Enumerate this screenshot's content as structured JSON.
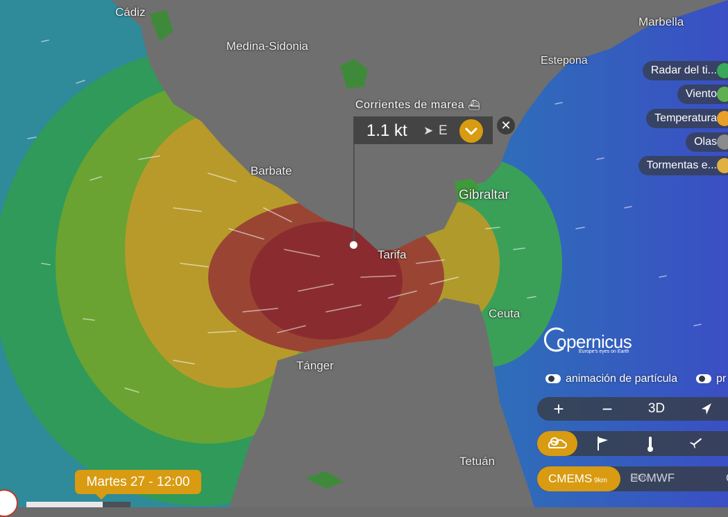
{
  "map": {
    "cities": [
      {
        "key": "cadiz",
        "label": "Cádiz"
      },
      {
        "key": "medina",
        "label": "Medina-Sidonia"
      },
      {
        "key": "marbella",
        "label": "Marbella"
      },
      {
        "key": "estepona",
        "label": "Estepona"
      },
      {
        "key": "barbate",
        "label": "Barbate"
      },
      {
        "key": "gibraltar",
        "label": "Gibraltar"
      },
      {
        "key": "tarifa",
        "label": "Tarifa"
      },
      {
        "key": "ceuta",
        "label": "Ceuta"
      },
      {
        "key": "tanger",
        "label": "Tánger"
      },
      {
        "key": "tetuan",
        "label": "Tetuán"
      }
    ],
    "colors": {
      "land": "#6e6e6e",
      "land_light": "#7a7a7a",
      "sea_blue": "#2f5fc4",
      "current_strong": "#8a2a2a",
      "accent": "#d89b11"
    }
  },
  "popup": {
    "layer_label": "Corrientes de marea",
    "layer_icon": "boat-waves-icon",
    "value": "1.1 kt",
    "direction_arrow": "➤",
    "direction": "E",
    "expand_icon": "chevron-down-icon",
    "close_icon": "close-icon"
  },
  "layers": [
    {
      "label": "Radar del ti...",
      "color": "#3aa85a"
    },
    {
      "label": "Viento",
      "color": "#5fb052"
    },
    {
      "label": "Temperatura",
      "color": "#e8a02a"
    },
    {
      "label": "Olas",
      "color": "#8a8a8a"
    },
    {
      "label": "Tormentas e...",
      "color": "#e0b040"
    }
  ],
  "logo": {
    "name": "opernicus",
    "tagline": "Europe's eyes on Earth"
  },
  "toggles": [
    {
      "label": "animación de partícula"
    },
    {
      "label": "pr"
    }
  ],
  "controls": {
    "zoom_in": "+",
    "zoom_out": "−",
    "view_3d": "3D",
    "locate_icon": "navigation-arrow-icon",
    "overlay_icons": [
      "weather-icon",
      "flag-wind-icon",
      "thermometer-icon",
      "airplane-icon"
    ],
    "models": [
      {
        "name": "CMEMS",
        "res": "9km"
      },
      {
        "name": "ECMWF",
        "res": "13km"
      },
      {
        "name": "C",
        "res": ""
      }
    ]
  },
  "timeline": {
    "label": "Martes 27 - 12:00"
  }
}
